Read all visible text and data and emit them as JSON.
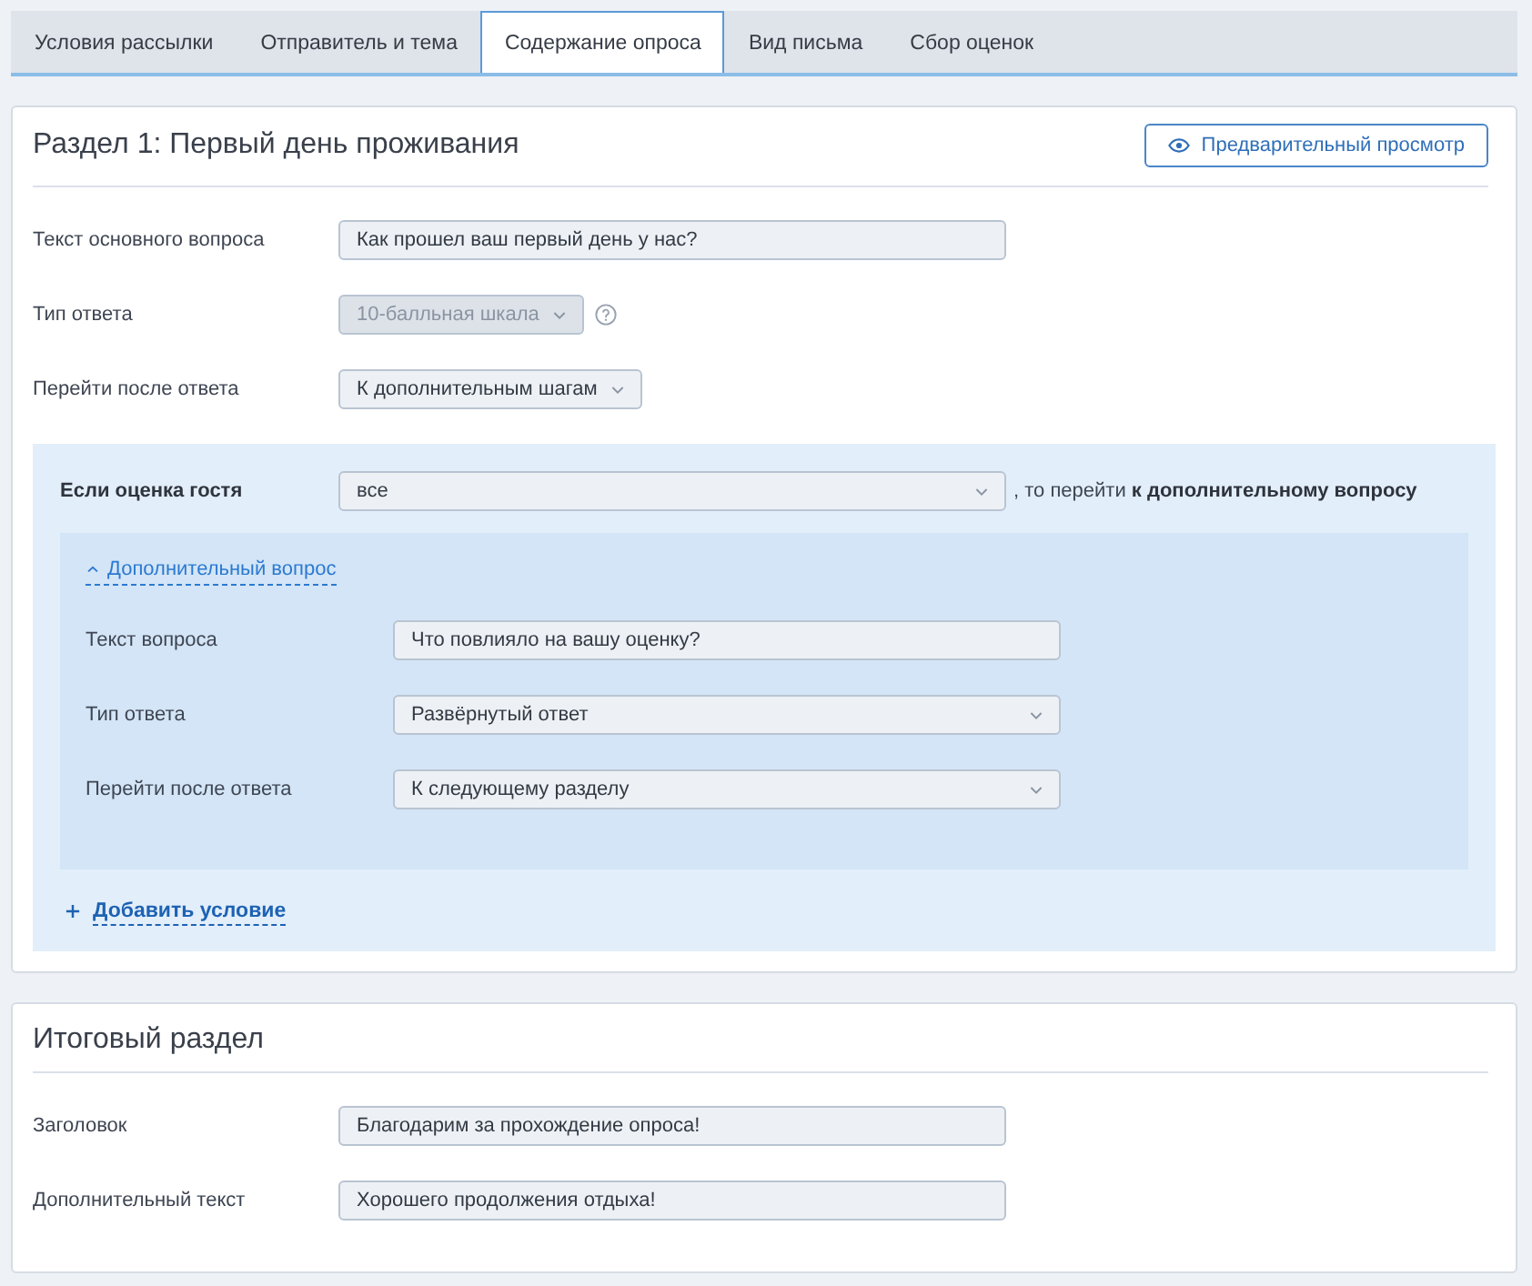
{
  "tabs": [
    {
      "label": "Условия рассылки",
      "selected": false
    },
    {
      "label": "Отправитель и тема",
      "selected": false
    },
    {
      "label": "Содержание опроса",
      "selected": true
    },
    {
      "label": "Вид письма",
      "selected": false
    },
    {
      "label": "Сбор оценок",
      "selected": false
    }
  ],
  "section": {
    "title": "Раздел 1: Первый день проживания",
    "preview_button": "Предварительный просмотр",
    "fields": [
      {
        "kind": "input",
        "label": "Текст основного вопроса",
        "value": "Как прошел ваш первый день у нас?"
      },
      {
        "kind": "select",
        "label": "Тип ответа",
        "value": "10-балльная шкала",
        "disabled": true,
        "help": true
      },
      {
        "kind": "select",
        "label": "Перейти после ответа",
        "value": "К дополнительным шагам",
        "disabled": false
      }
    ],
    "condition": {
      "label": "Если оценка гостя",
      "value": "все",
      "result": ", то перейти **к дополнительному вопросу**",
      "follow_up": {
        "toggle": "Дополнительный вопрос",
        "expanded": true,
        "fields": [
          {
            "kind": "input",
            "label": "Текст вопроса",
            "value": "Что повлияло на вашу оценку?"
          },
          {
            "kind": "select",
            "label": "Тип ответа",
            "value": "Развёрнутый ответ"
          },
          {
            "kind": "select",
            "label": "Перейти после ответа",
            "value": "К следующему разделу"
          }
        ]
      },
      "add_button": "Добавить условие"
    }
  },
  "final_section": {
    "title": "Итоговый раздел",
    "fields": [
      {
        "kind": "input",
        "label": "Заголовок",
        "value": "Благодарим за прохождение опроса!"
      },
      {
        "kind": "input",
        "label": "Дополнительный текст",
        "value": "Хорошего продолжения отдыха!"
      }
    ]
  }
}
